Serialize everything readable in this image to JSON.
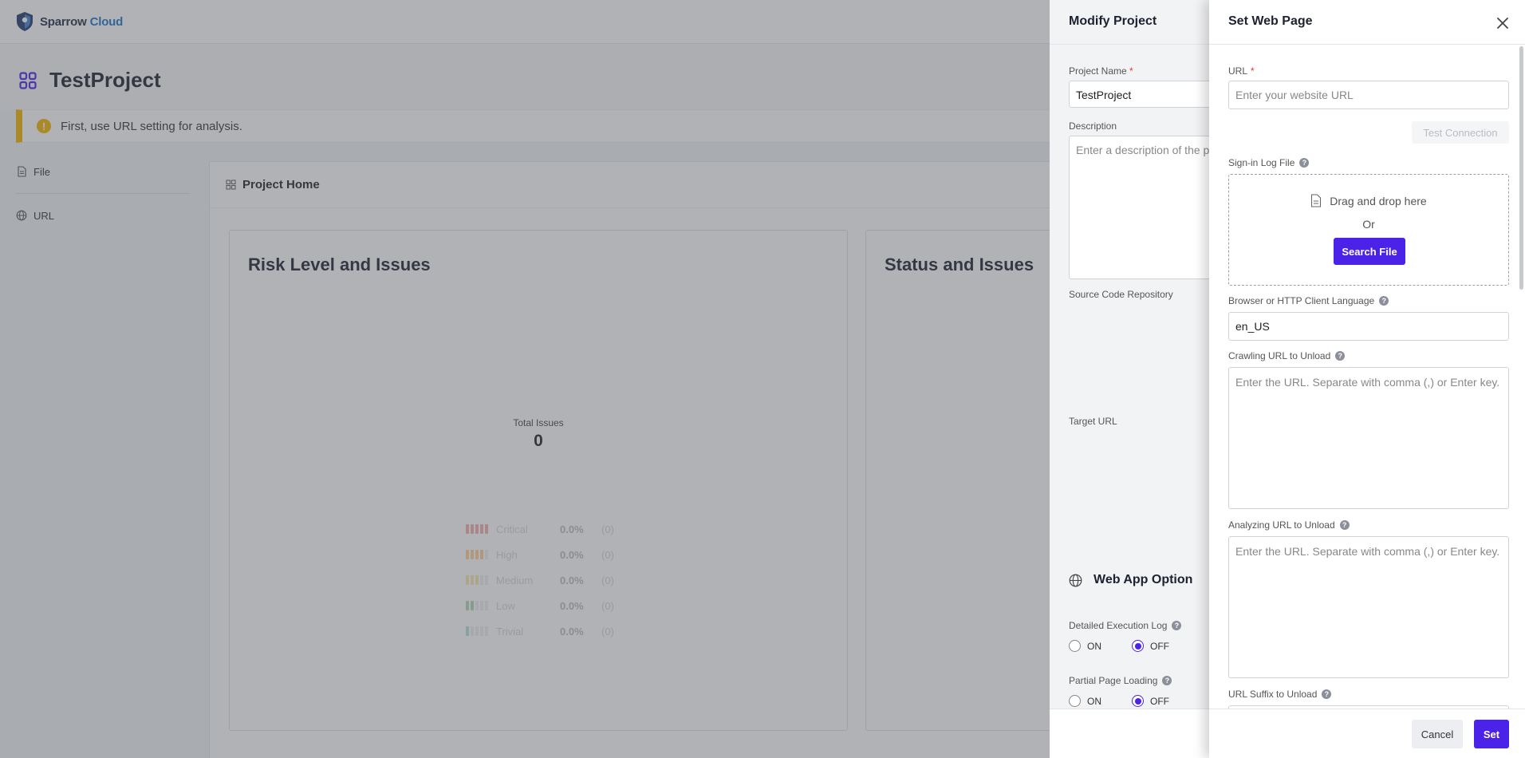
{
  "app": {
    "brand_primary": "Sparrow",
    "brand_accent": "Cloud",
    "project_title": "TestProject",
    "notice": "First, use URL setting for analysis.",
    "nav": [
      {
        "label": "File",
        "icon": "file-icon"
      },
      {
        "label": "URL",
        "icon": "globe-icon"
      }
    ],
    "content_title": "Project Home",
    "cards": {
      "risk_title": "Risk Level and Issues",
      "status_title": "Status and Issues",
      "total_label": "Total Issues",
      "total_value": "0"
    },
    "risk_levels": [
      {
        "name": "Critical",
        "pct": "0.0%",
        "count": "(0)",
        "color": "#e53935",
        "filled": 5
      },
      {
        "name": "High",
        "pct": "0.0%",
        "count": "(0)",
        "color": "#fb8c00",
        "filled": 4
      },
      {
        "name": "Medium",
        "pct": "0.0%",
        "count": "(0)",
        "color": "#f4c542",
        "filled": 3
      },
      {
        "name": "Low",
        "pct": "0.0%",
        "count": "(0)",
        "color": "#43a047",
        "filled": 2
      },
      {
        "name": "Trivial",
        "pct": "0.0%",
        "count": "(0)",
        "color": "#4db6ac",
        "filled": 1
      }
    ]
  },
  "modify": {
    "title": "Modify Project",
    "project_name_label": "Project Name",
    "project_name_value": "TestProject",
    "description_label": "Description",
    "description_placeholder": "Enter a description of the p",
    "source_repo_label": "Source Code Repository",
    "target_url_label": "Target URL",
    "web_app_option": "Web App Option",
    "detailed_log_label": "Detailed Execution Log",
    "partial_loading_label": "Partial Page Loading",
    "on_label": "ON",
    "off_label": "OFF"
  },
  "panel": {
    "title": "Set Web Page",
    "url_label": "URL",
    "url_placeholder": "Enter your website URL",
    "test_connection": "Test Connection",
    "signin_label": "Sign-in Log File",
    "drop_text": "Drag and drop here",
    "drop_or": "Or",
    "search_file": "Search File",
    "language_label": "Browser or HTTP Client Language",
    "language_value": "en_US",
    "crawling_label": "Crawling URL to Unload",
    "crawling_placeholder": "Enter the URL. Separate with comma (,) or Enter key.",
    "analyzing_label": "Analyzing URL to Unload",
    "analyzing_placeholder": "Enter the URL. Separate with comma (,) or Enter key.",
    "suffix_label": "URL Suffix to Unload",
    "cancel": "Cancel",
    "set": "Set"
  },
  "colors": {
    "accent": "#4b22e8",
    "warning": "#f4b400",
    "brand_blue": "#1a73c9"
  }
}
